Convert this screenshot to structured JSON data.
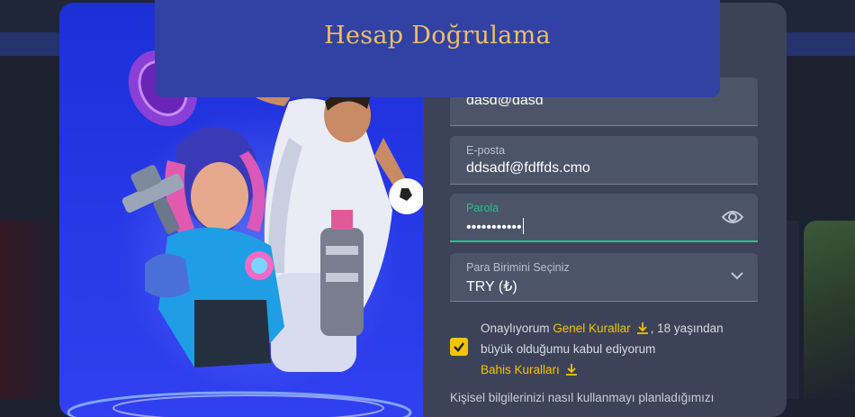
{
  "banner": {
    "title": "Hesap Doğrulama"
  },
  "form": {
    "username": {
      "value": "dasd@dasd"
    },
    "email": {
      "label": "E-posta",
      "value": "ddsadf@fdffds.cmo"
    },
    "password": {
      "label": "Parola",
      "value": "•••••••••••"
    },
    "currency": {
      "label": "Para Birimini Seçiniz",
      "value": "TRY (₺)"
    }
  },
  "consent": {
    "checked": true,
    "prefix": "Onaylıyorum ",
    "general_rules": "Genel Kurallar",
    "middle": ", 18 yaşından büyük olduğumu kabul ediyorum",
    "betting_rules": "Bahis Kuralları"
  },
  "footer": {
    "note": "Kişisel bilgilerinizi nasıl kullanmayı planladığımızı"
  },
  "icons": {
    "eye": "eye-icon",
    "chevron": "chevron-down-icon",
    "download": "download-icon",
    "check": "check-icon"
  },
  "colors": {
    "accent": "#f5c400",
    "focus": "#22c38e",
    "banner": "#3142a4",
    "banner_text": "#f3bf5f"
  }
}
